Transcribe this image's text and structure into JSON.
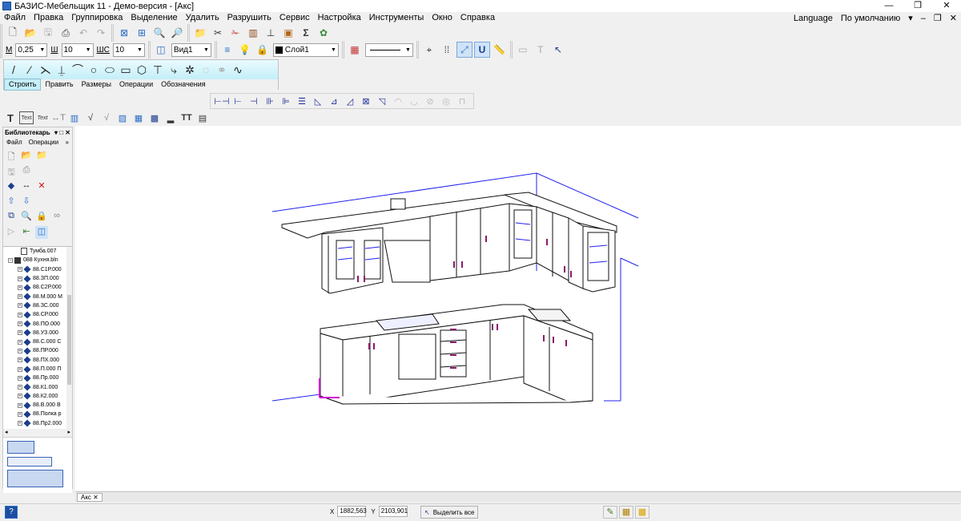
{
  "window": {
    "title": "БАЗИС-Мебельщик 11 - Демо-версия - [Акс]",
    "controls": [
      "—",
      "❐",
      "✕"
    ]
  },
  "menu": {
    "items": [
      "Файл",
      "Правка",
      "Группировка",
      "Выделение",
      "Удалить",
      "Разрушить",
      "Сервис",
      "Настройка",
      "Инструменты",
      "Окно",
      "Справка"
    ],
    "language": "Language",
    "preset": "По умолчанию",
    "preset_controls": [
      "▾",
      "–",
      "❐",
      "✕"
    ]
  },
  "props_toolbar": {
    "m_label": "М",
    "line_width": "0,25",
    "sh_label": "Ш",
    "font_size": "10",
    "shs_label": "ШС",
    "shs_value": "10",
    "view": "Вид1",
    "layer": "Слой1"
  },
  "draw_panel": {
    "tabs": [
      "Строить",
      "Править",
      "Размеры",
      "Операции",
      "Обозначения"
    ],
    "active_tab": "Строить"
  },
  "library": {
    "title": "Библиотекарь",
    "header_controls": [
      "▾",
      "□",
      "✕"
    ],
    "menu": [
      "Файл",
      "Операции"
    ],
    "items": [
      "Тумба.007",
      "088 Кухня.bln",
      "88.С1Р.000",
      "88.ЗП.000",
      "88.С2Р.000",
      "88.М.000 М",
      "88.ЗС.000",
      "88.СР.000",
      "88.ПО.000",
      "88.УЗ.000",
      "88.С.000 С",
      "88.ПР.000",
      "88.ПХ.000",
      "88.П.000 П",
      "88.Пр.000",
      "88.К1.000",
      "88.К2.000",
      "88.В.000 В",
      "88.Полка р",
      "88.Пр2.000"
    ]
  },
  "document_tabs": [
    {
      "label": "Акс",
      "close": "✕"
    }
  ],
  "status": {
    "help": "?",
    "x_label": "X",
    "x_value": "1882,563",
    "y_label": "Y",
    "y_value": "2103,901",
    "select_all": "Выделить все"
  },
  "colors": {
    "accent_blue": "#2b6cc4",
    "handle_magenta": "#8c1a6a",
    "guide_blue": "#1a1aee",
    "axis_magenta": "#d400d4"
  }
}
